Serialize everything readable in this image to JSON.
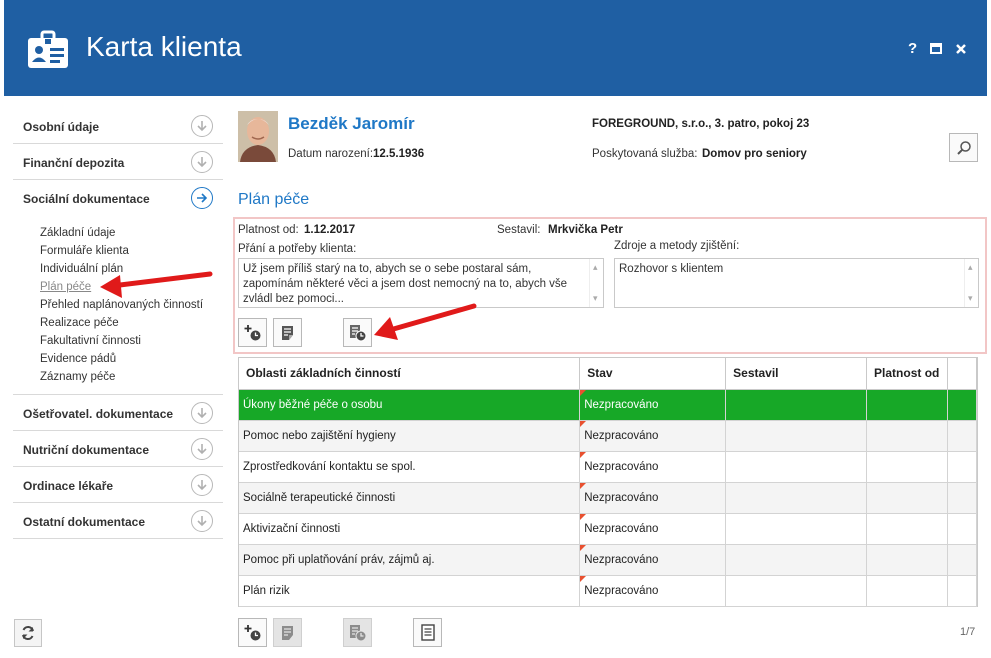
{
  "app": {
    "title": "Karta klienta",
    "help_label": "?",
    "brand_color": "#1f5fa3"
  },
  "sidebar": {
    "sections_top": [
      {
        "label": "Osobní údaje",
        "icon": "chevron-down-circle-icon"
      },
      {
        "label": "Finanční depozita",
        "icon": "chevron-down-circle-icon"
      },
      {
        "label": "Sociální dokumentace",
        "icon": "arrow-right-circle-icon"
      }
    ],
    "subitems": [
      "Základní údaje",
      "Formuláře klienta",
      "Individuální plán",
      "Plán péče",
      "Přehled naplánovaných činností",
      "Realizace péče",
      "Fakultativní činnosti",
      "Evidence pádů",
      "Záznamy péče"
    ],
    "active_subitem": "Plán péče",
    "sections_bottom": [
      {
        "label": "Ošetřovatel. dokumentace",
        "icon": "chevron-down-circle-icon"
      },
      {
        "label": "Nutriční dokumentace",
        "icon": "chevron-down-circle-icon"
      },
      {
        "label": "Ordinace lékaře",
        "icon": "chevron-down-circle-icon"
      },
      {
        "label": "Ostatní dokumentace",
        "icon": "chevron-down-circle-icon"
      }
    ]
  },
  "client": {
    "name": "Bezděk Jaromír",
    "birth_label": "Datum narození:",
    "birth_value": "12.5.1936",
    "facility": "FOREGROUND, s.r.o., 3. patro, pokoj 23",
    "service_label": "Poskytovaná služba:",
    "service_value": "Domov pro seniory"
  },
  "plan": {
    "section_title": "Plán péče",
    "valid_from_label": "Platnost od:",
    "valid_from_value": "1.12.2017",
    "author_label": "Sestavil:",
    "author_value": "Mrkvička Petr",
    "wishes_label": "Přání a potřeby klienta:",
    "wishes_text": "Už jsem příliš starý na to, abych se o sebe postaral sám, zapomínám některé věci a jsem dost nemocný na to, abych vše zvládl bez pomoci...",
    "sources_label": "Zdroje a metody zjištění:",
    "sources_text": "Rozhovor s klientem"
  },
  "table": {
    "columns": [
      "Oblasti základních činností",
      "Stav",
      "Sestavil",
      "Platnost od"
    ],
    "rows": [
      {
        "area": "Úkony běžné péče o osobu",
        "status": "Nezpracováno"
      },
      {
        "area": "Pomoc nebo zajištění hygieny",
        "status": "Nezpracováno"
      },
      {
        "area": "Zprostředkování kontaktu se spol.",
        "status": "Nezpracováno"
      },
      {
        "area": "Sociálně terapeutické činnosti",
        "status": "Nezpracováno"
      },
      {
        "area": "Aktivizační činnosti",
        "status": "Nezpracováno"
      },
      {
        "area": "Pomoc při uplatňování práv, zájmů aj.",
        "status": "Nezpracováno"
      },
      {
        "area": "Plán rizik",
        "status": "Nezpracováno"
      }
    ],
    "selected_row_color": "#17a827",
    "pager": "1/7"
  },
  "colors": {
    "accent": "#1f78c6",
    "annotation_arrow": "#e01a1a"
  }
}
